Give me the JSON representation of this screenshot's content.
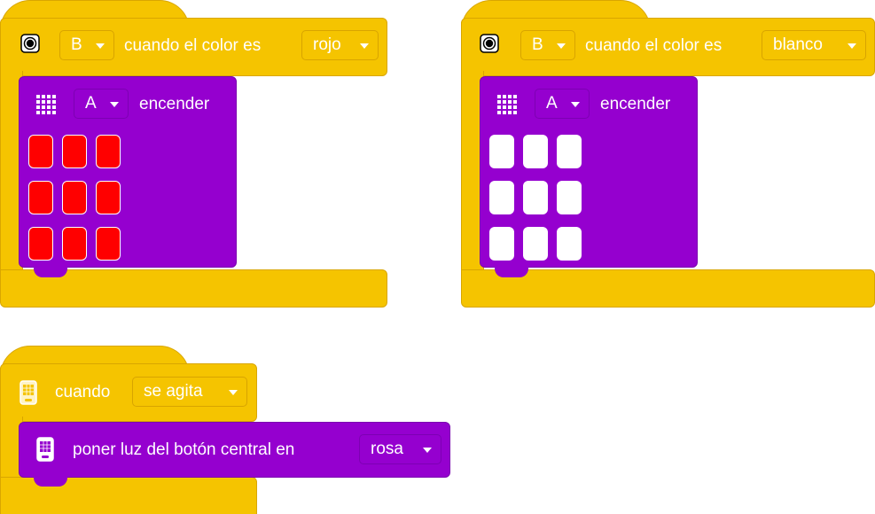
{
  "blocks": [
    {
      "hat": {
        "color_condition_label": "cuando el color es",
        "sensor_port": "B",
        "color_value": "rojo",
        "icon": "color-sensor-icon"
      },
      "inner": {
        "label": "encender",
        "port": "A",
        "icon": "light-matrix-icon",
        "pixel_color": "#ff0000"
      }
    },
    {
      "hat": {
        "color_condition_label": "cuando el color es",
        "sensor_port": "B",
        "color_value": "blanco",
        "icon": "color-sensor-icon"
      },
      "inner": {
        "label": "encender",
        "port": "A",
        "icon": "light-matrix-icon",
        "pixel_color": "#ffffff"
      }
    },
    {
      "hat": {
        "label": "cuando",
        "gesture_value": "se agita",
        "icon": "hub-icon"
      },
      "inner": {
        "label": "poner luz del botón central en",
        "color_value": "rosa",
        "icon": "hub-icon"
      }
    }
  ],
  "colors": {
    "event_yellow": "#f5c400",
    "light_purple": "#9500cf"
  }
}
